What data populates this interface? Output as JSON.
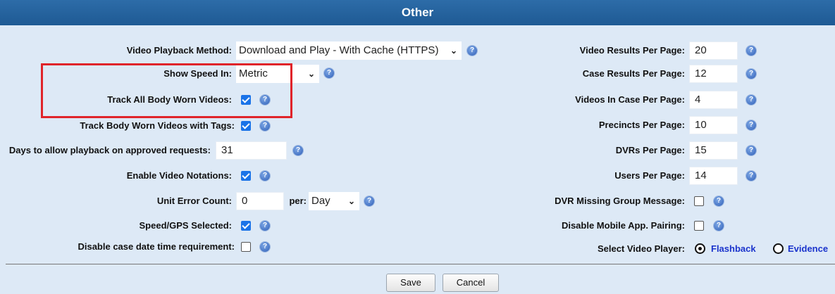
{
  "section": {
    "title": "Other"
  },
  "left": {
    "video_playback_method": {
      "label": "Video Playback Method:",
      "value": "Download and Play - With Cache (HTTPS)"
    },
    "show_speed_in": {
      "label": "Show Speed In:",
      "value": "Metric"
    },
    "track_all_bwv": {
      "label": "Track All Body Worn Videos:",
      "checked": true
    },
    "track_bwv_tags": {
      "label": "Track Body Worn Videos with Tags:",
      "checked": true
    },
    "days_playback": {
      "label": "Days to allow playback on approved requests:",
      "value": "31"
    },
    "enable_notations": {
      "label": "Enable Video Notations:",
      "checked": true
    },
    "unit_error_count": {
      "label": "Unit Error Count:",
      "value": "0",
      "per_label": "per:",
      "per_value": "Day"
    },
    "speed_gps": {
      "label": "Speed/GPS Selected:",
      "checked": true
    },
    "disable_case_date": {
      "label": "Disable case date time requirement:",
      "checked": false
    }
  },
  "right": {
    "video_results": {
      "label": "Video Results Per Page:",
      "value": "20"
    },
    "case_results": {
      "label": "Case Results Per Page:",
      "value": "12"
    },
    "videos_in_case": {
      "label": "Videos In Case Per Page:",
      "value": "4"
    },
    "precincts": {
      "label": "Precincts Per Page:",
      "value": "10"
    },
    "dvrs": {
      "label": "DVRs Per Page:",
      "value": "15"
    },
    "users": {
      "label": "Users Per Page:",
      "value": "14"
    },
    "dvr_missing_group": {
      "label": "DVR Missing Group Message:",
      "checked": false
    },
    "disable_mobile_pairing": {
      "label": "Disable Mobile App. Pairing:",
      "checked": false
    },
    "select_player": {
      "label": "Select Video Player:",
      "options": [
        "Flashback",
        "Evidence"
      ],
      "selected": "Flashback"
    }
  },
  "buttons": {
    "save": "Save",
    "cancel": "Cancel"
  },
  "colors": {
    "header": "#1e5a94",
    "panel": "#dde9f6",
    "highlight_box": "#e0242a",
    "checkbox": "#1a73e8",
    "radio_label": "#1a33cc"
  },
  "icons": {
    "help": "help-icon",
    "dropdown": "chevron-down-icon"
  }
}
